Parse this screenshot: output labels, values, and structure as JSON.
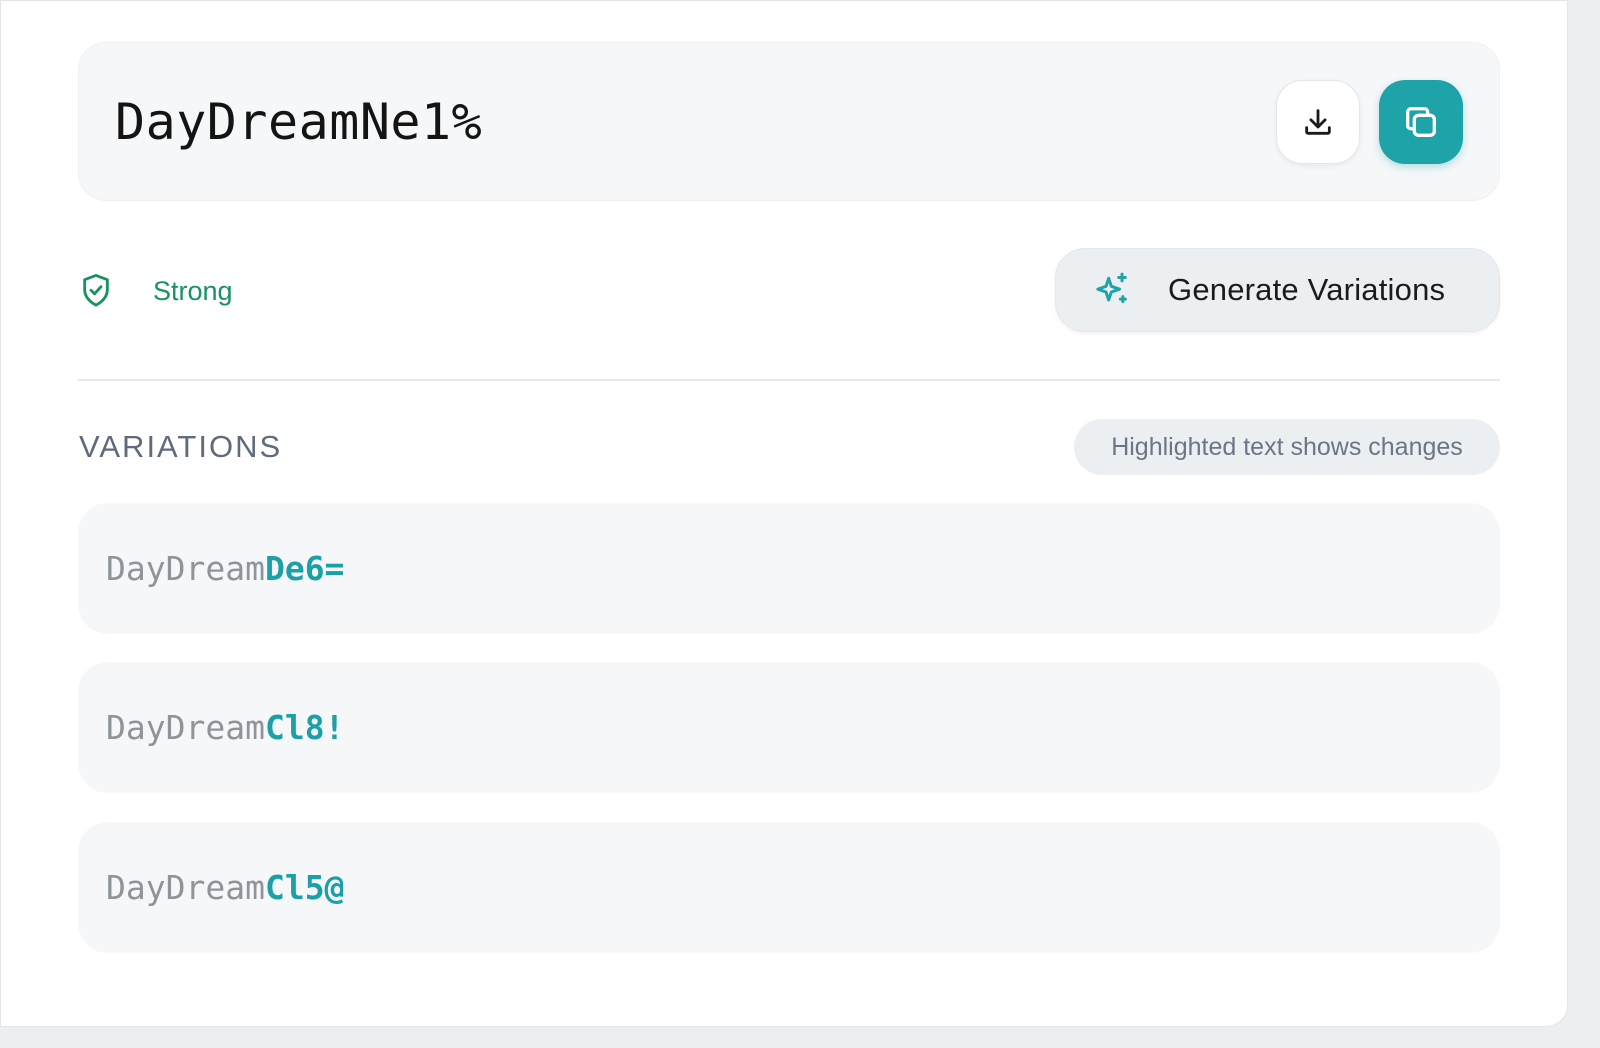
{
  "password": {
    "value": "DayDreamNe1%"
  },
  "actions": {
    "download_icon": "download-icon",
    "copy_icon": "copy-icon",
    "generate_label": "Generate Variations",
    "generate_icon": "sparkles-icon"
  },
  "strength": {
    "label": "Strong",
    "icon": "shield-check-icon",
    "color": "#16935f"
  },
  "variations": {
    "title": "VARIATIONS",
    "hint": "Highlighted text shows changes",
    "items": [
      {
        "base": "DayDream",
        "changed": "De6="
      },
      {
        "base": "DayDream",
        "changed": "Cl8!"
      },
      {
        "base": "DayDream",
        "changed": "Cl5@"
      }
    ]
  },
  "colors": {
    "accent": "#1ea3a8",
    "strong": "#16935f"
  }
}
